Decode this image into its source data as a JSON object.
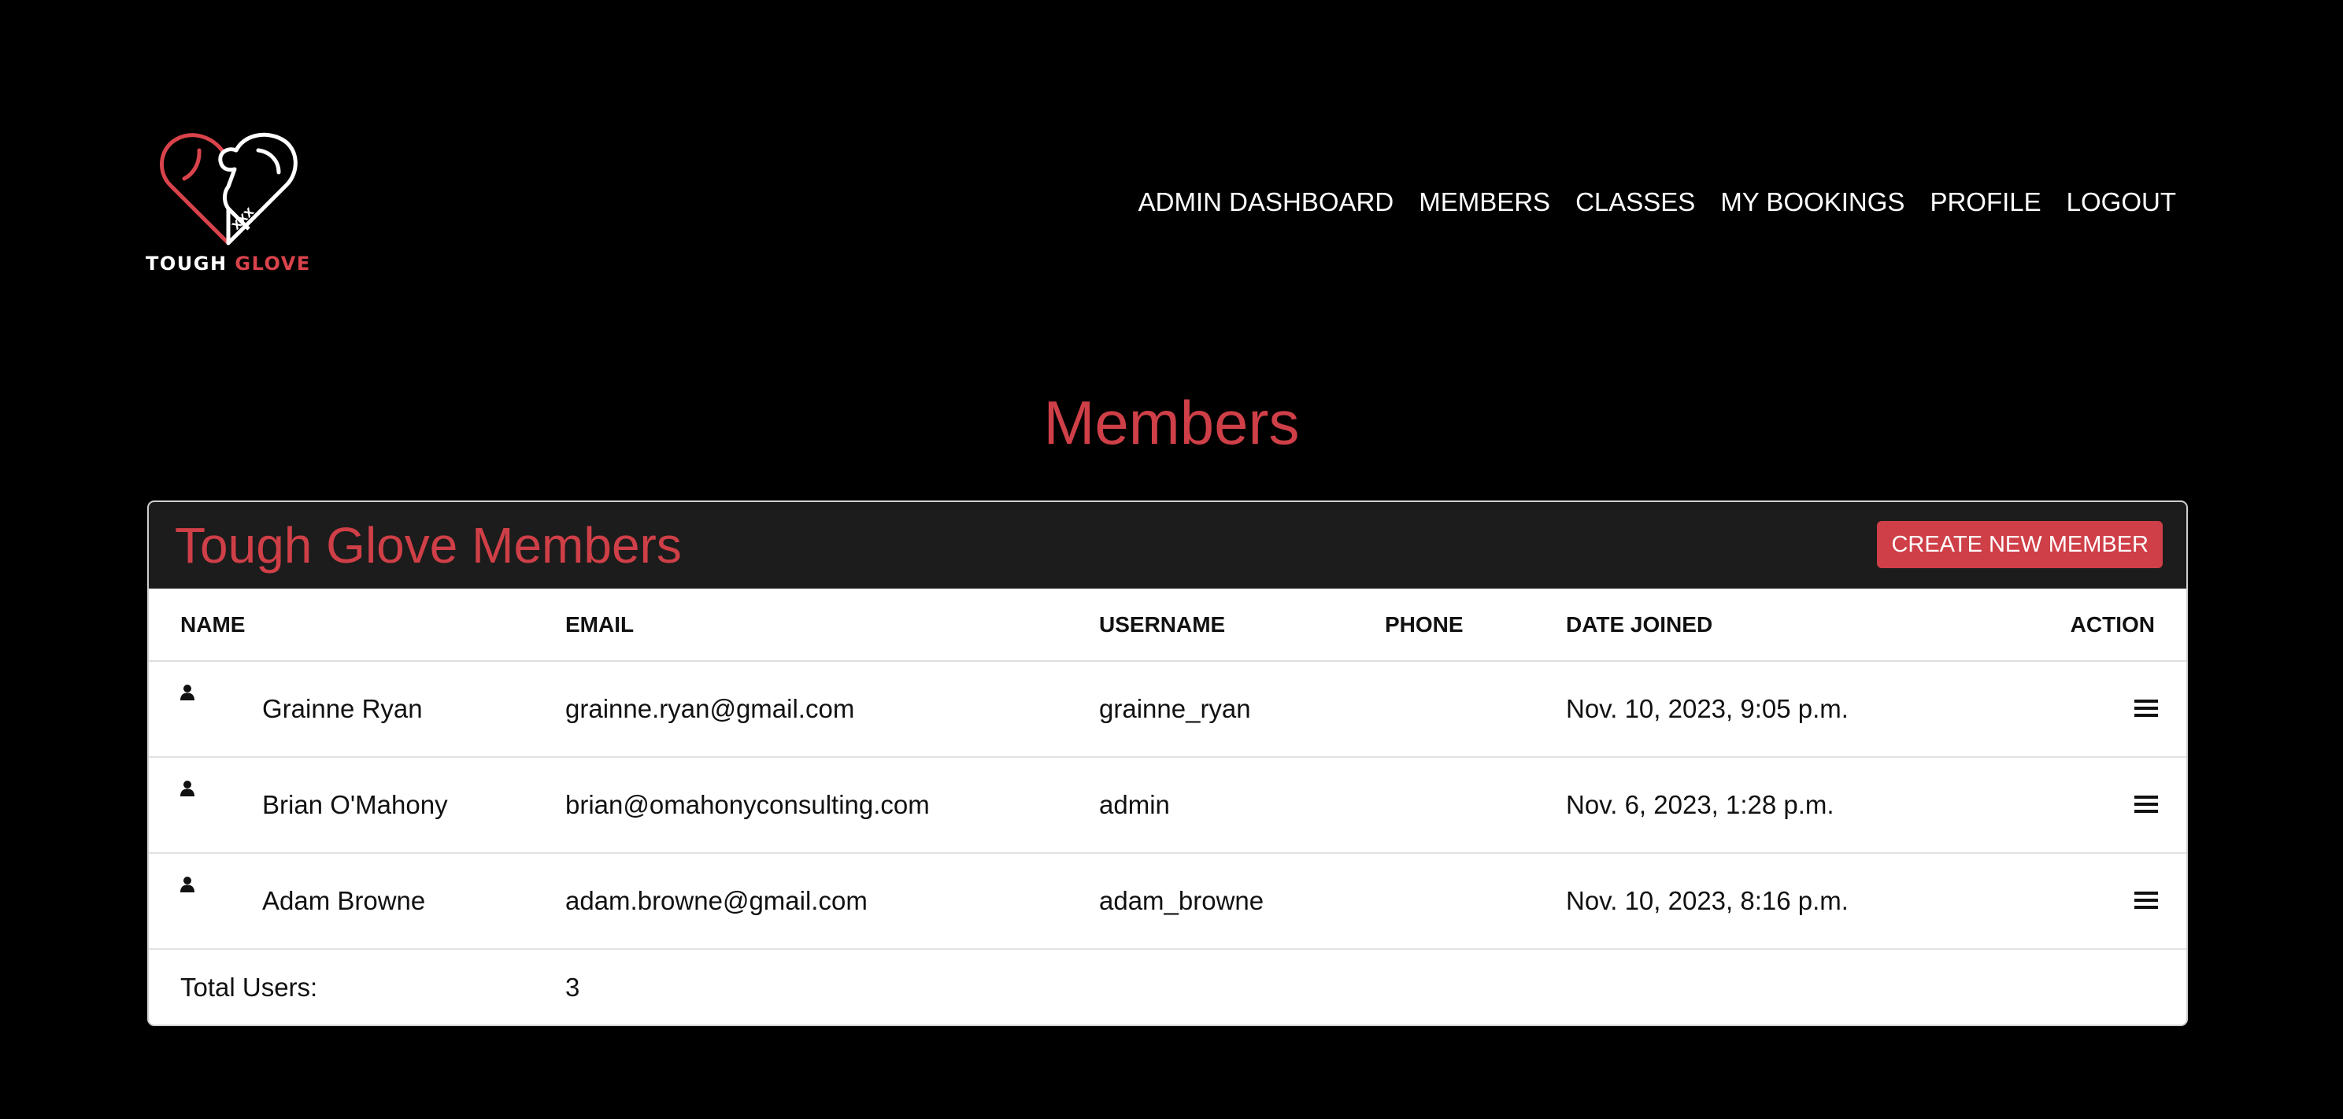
{
  "brand": {
    "name_white": "TOUGH",
    "name_red": "GLOVE",
    "glove_marking": "XXX"
  },
  "colors": {
    "accent": "#cf3f47",
    "background": "#000000",
    "card_header": "#1c1c1c"
  },
  "nav": [
    {
      "label": "ADMIN DASHBOARD"
    },
    {
      "label": "MEMBERS"
    },
    {
      "label": "CLASSES"
    },
    {
      "label": "MY BOOKINGS"
    },
    {
      "label": "PROFILE"
    },
    {
      "label": "LOGOUT"
    }
  ],
  "page_title": "Members",
  "card": {
    "title": "Tough Glove Members",
    "create_button": "CREATE NEW MEMBER"
  },
  "table": {
    "headers": {
      "name": "NAME",
      "email": "EMAIL",
      "username": "USERNAME",
      "phone": "PHONE",
      "date_joined": "DATE JOINED",
      "action": "ACTION"
    },
    "rows": [
      {
        "name": "Grainne Ryan",
        "email": "grainne.ryan@gmail.com",
        "username": "grainne_ryan",
        "phone": "",
        "date_joined": "Nov. 10, 2023, 9:05 p.m.",
        "row_icon": "user-icon",
        "action_icon": "menu-icon"
      },
      {
        "name": "Brian O'Mahony",
        "email": "brian@omahonyconsulting.com",
        "username": "admin",
        "phone": "",
        "date_joined": "Nov. 6, 2023, 1:28 p.m.",
        "row_icon": "user-icon",
        "action_icon": "menu-icon"
      },
      {
        "name": "Adam Browne",
        "email": "adam.browne@gmail.com",
        "username": "adam_browne",
        "phone": "",
        "date_joined": "Nov. 10, 2023, 8:16 p.m.",
        "row_icon": "user-icon",
        "action_icon": "menu-icon"
      }
    ],
    "total_label": "Total Users:",
    "total_value": "3"
  }
}
